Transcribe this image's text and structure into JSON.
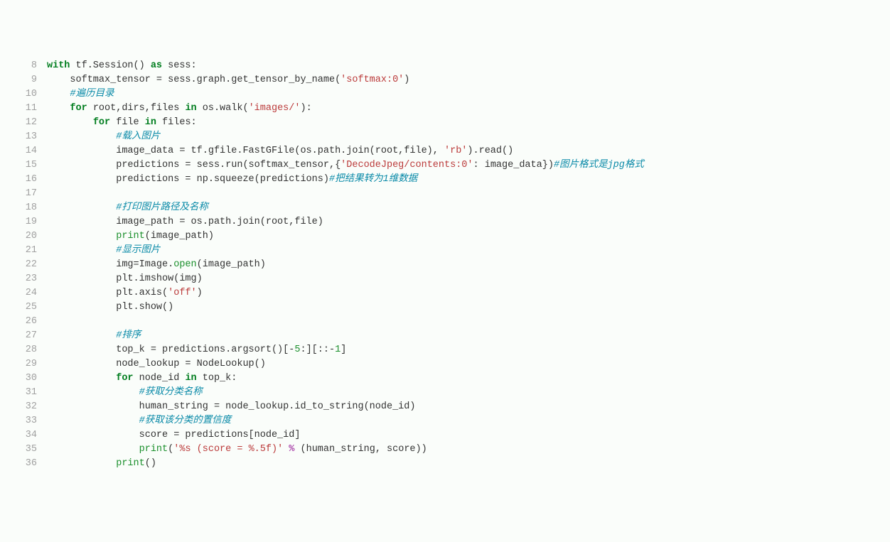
{
  "lineStart": 8,
  "lineEnd": 36,
  "lines": [
    [
      [
        "kw",
        "with"
      ],
      [
        "pl",
        " tf.Session() "
      ],
      [
        "kw",
        "as"
      ],
      [
        "pl",
        " sess:"
      ]
    ],
    [
      [
        "pl",
        "    softmax_tensor = sess.graph.get_tensor_by_name("
      ],
      [
        "str",
        "'softmax:0'"
      ],
      [
        "pl",
        ")"
      ]
    ],
    [
      [
        "pl",
        "    "
      ],
      [
        "cm",
        "#遍历目录"
      ]
    ],
    [
      [
        "pl",
        "    "
      ],
      [
        "kw",
        "for"
      ],
      [
        "pl",
        " root,dirs,files "
      ],
      [
        "kw",
        "in"
      ],
      [
        "pl",
        " os.walk("
      ],
      [
        "str",
        "'images/'"
      ],
      [
        "pl",
        "):"
      ]
    ],
    [
      [
        "pl",
        "        "
      ],
      [
        "kw",
        "for"
      ],
      [
        "pl",
        " file "
      ],
      [
        "kw",
        "in"
      ],
      [
        "pl",
        " files:"
      ]
    ],
    [
      [
        "pl",
        "            "
      ],
      [
        "cm",
        "#载入图片"
      ]
    ],
    [
      [
        "pl",
        "            image_data = tf.gfile.FastGFile(os.path.join(root,file), "
      ],
      [
        "str",
        "'rb'"
      ],
      [
        "pl",
        ").read()"
      ]
    ],
    [
      [
        "pl",
        "            predictions = sess.run(softmax_tensor,{"
      ],
      [
        "str",
        "'DecodeJpeg/contents:0'"
      ],
      [
        "pl",
        ": image_data})"
      ],
      [
        "cm",
        "#图片格式是jpg格式"
      ]
    ],
    [
      [
        "pl",
        "            predictions = np.squeeze(predictions)"
      ],
      [
        "cm",
        "#把结果转为1维数据"
      ]
    ],
    [
      [
        "pl",
        "            "
      ]
    ],
    [
      [
        "pl",
        "            "
      ],
      [
        "cm",
        "#打印图片路径及名称"
      ]
    ],
    [
      [
        "pl",
        "            image_path = os.path.join(root,file)"
      ]
    ],
    [
      [
        "pl",
        "            "
      ],
      [
        "fn",
        "print"
      ],
      [
        "pl",
        "(image_path)"
      ]
    ],
    [
      [
        "pl",
        "            "
      ],
      [
        "cm",
        "#显示图片"
      ]
    ],
    [
      [
        "pl",
        "            img=Image."
      ],
      [
        "fn",
        "open"
      ],
      [
        "pl",
        "(image_path)"
      ]
    ],
    [
      [
        "pl",
        "            plt.imshow(img)"
      ]
    ],
    [
      [
        "pl",
        "            plt.axis("
      ],
      [
        "str",
        "'off'"
      ],
      [
        "pl",
        ")"
      ]
    ],
    [
      [
        "pl",
        "            plt.show()"
      ]
    ],
    [
      [
        "pl",
        "            "
      ]
    ],
    [
      [
        "pl",
        "            "
      ],
      [
        "cm",
        "#排序"
      ]
    ],
    [
      [
        "pl",
        "            top_k = predictions.argsort()[-"
      ],
      [
        "num",
        "5"
      ],
      [
        "pl",
        ":][::-"
      ],
      [
        "num",
        "1"
      ],
      [
        "pl",
        "]"
      ]
    ],
    [
      [
        "pl",
        "            node_lookup = NodeLookup()"
      ]
    ],
    [
      [
        "pl",
        "            "
      ],
      [
        "kw",
        "for"
      ],
      [
        "pl",
        " node_id "
      ],
      [
        "kw",
        "in"
      ],
      [
        "pl",
        " top_k:"
      ]
    ],
    [
      [
        "pl",
        "                "
      ],
      [
        "cm",
        "#获取分类名称"
      ]
    ],
    [
      [
        "pl",
        "                human_string = node_lookup.id_to_string(node_id)"
      ]
    ],
    [
      [
        "pl",
        "                "
      ],
      [
        "cm",
        "#获取该分类的置信度"
      ]
    ],
    [
      [
        "pl",
        "                score = predictions[node_id]"
      ]
    ],
    [
      [
        "pl",
        "                "
      ],
      [
        "fn",
        "print"
      ],
      [
        "pl",
        "("
      ],
      [
        "str",
        "'%s (score = %.5f)'"
      ],
      [
        "pl",
        " "
      ],
      [
        "op",
        "%"
      ],
      [
        "pl",
        " (human_string, score))"
      ]
    ],
    [
      [
        "pl",
        "            "
      ],
      [
        "fn",
        "print"
      ],
      [
        "pl",
        "()"
      ]
    ]
  ]
}
